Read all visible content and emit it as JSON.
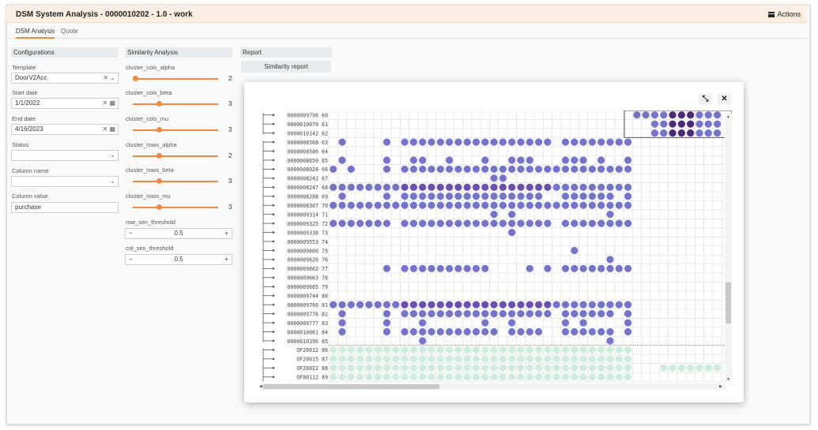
{
  "app": {
    "title": "DSM System Analysis - 0000010202 - 1.0 - work",
    "actions_label": "Actions"
  },
  "tabs": [
    {
      "label": "DSM Analysis"
    },
    {
      "label": "Quote"
    }
  ],
  "config": {
    "header": "Configurations",
    "template_label": "Template",
    "template_value": "DoorV2Acc",
    "start_label": "Start date",
    "start_value": "1/1/2022",
    "end_label": "End date",
    "end_value": "4/16/2023",
    "status_label": "Status",
    "status_value": "",
    "colname_label": "Column name",
    "colname_value": "",
    "colvalue_label": "Column value",
    "colvalue_value": "purchase"
  },
  "similarity": {
    "header": "Similarity Analysis",
    "sliders": [
      {
        "label": "cluster_cols_alpha",
        "value": "2",
        "fraction": 0.0
      },
      {
        "label": "cluster_cols_beta",
        "value": "3",
        "fraction": 0.3
      },
      {
        "label": "cluster_cols_mu",
        "value": "3",
        "fraction": 0.3
      },
      {
        "label": "cluster_rows_alpha",
        "value": "2",
        "fraction": 0.3
      },
      {
        "label": "cluster_rows_beta",
        "value": "3",
        "fraction": 0.3
      },
      {
        "label": "cluster_rows_mu",
        "value": "3",
        "fraction": 0.3
      }
    ],
    "row_threshold_label": "row_sim_threshold",
    "row_threshold_value": "0.5",
    "col_threshold_label": "col_sim_threshold",
    "col_threshold_value": "0.5"
  },
  "report": {
    "header": "Report",
    "button_label": "Similarity report"
  },
  "matrix": {
    "rows": [
      {
        "id": "0000009796",
        "n": "60",
        "p": "top1"
      },
      {
        "id": "0000010070",
        "n": "61",
        "p": "top2"
      },
      {
        "id": "0000010142",
        "n": "62",
        "p": "top3"
      },
      {
        "id": "0000008568",
        "n": "63",
        "p": "r63"
      },
      {
        "id": "0000008586",
        "n": "64",
        "p": "empty"
      },
      {
        "id": "0000008650",
        "n": "65",
        "p": "r65"
      },
      {
        "id": "0000008028",
        "n": "66",
        "p": "r66"
      },
      {
        "id": "0000008242",
        "n": "67",
        "p": "r67"
      },
      {
        "id": "0000008247",
        "n": "68",
        "p": "fullpurple"
      },
      {
        "id": "0000008288",
        "n": "69",
        "p": "r69"
      },
      {
        "id": "0000008307",
        "n": "70",
        "p": "full"
      },
      {
        "id": "0000009314",
        "n": "71",
        "p": "r71"
      },
      {
        "id": "0000009325",
        "n": "72",
        "p": "r72"
      },
      {
        "id": "0000009338",
        "n": "73",
        "p": "r73"
      },
      {
        "id": "0000009553",
        "n": "74",
        "p": "empty"
      },
      {
        "id": "0000009600",
        "n": "75",
        "p": "r75"
      },
      {
        "id": "0000009620",
        "n": "76",
        "p": "r76"
      },
      {
        "id": "0000009662",
        "n": "77",
        "p": "r77"
      },
      {
        "id": "0000009663",
        "n": "78",
        "p": "empty"
      },
      {
        "id": "0000009685",
        "n": "79",
        "p": "empty"
      },
      {
        "id": "0000009744",
        "n": "80",
        "p": "empty"
      },
      {
        "id": "0000009766",
        "n": "81",
        "p": "fullpurple"
      },
      {
        "id": "0000009776",
        "n": "82",
        "p": "r82"
      },
      {
        "id": "0000009777",
        "n": "83",
        "p": "r83"
      },
      {
        "id": "0000010061",
        "n": "84",
        "p": "r84"
      },
      {
        "id": "0000010196",
        "n": "85",
        "p": "r85"
      },
      {
        "id": "OF20012",
        "n": "86",
        "p": "green"
      },
      {
        "id": "OF20015",
        "n": "87",
        "p": "green"
      },
      {
        "id": "OF20022",
        "n": "88",
        "p": "greenlong"
      },
      {
        "id": "OF80112",
        "n": "89",
        "p": "green"
      }
    ],
    "colors": {
      "blue": "#7474cc",
      "purple": "#6b4fb3",
      "dark": "#4a2a7a",
      "green": "#cdeedd",
      "grid": "#dddddd"
    }
  }
}
